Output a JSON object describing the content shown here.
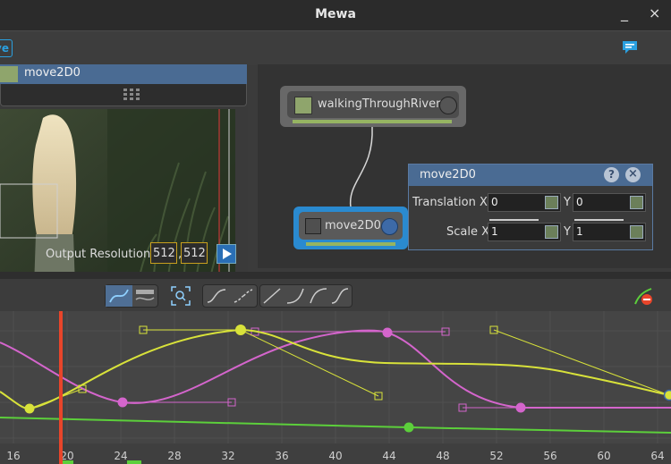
{
  "window": {
    "title": "Mewa",
    "minimize": "_",
    "close": "×"
  },
  "toolbar": {
    "save_fragment": "ve"
  },
  "viewer": {
    "node_name": "move2D0",
    "output_resolution_label": "Output Resolution:",
    "width": "512",
    "height": "512",
    "separator": ","
  },
  "nodes": [
    {
      "name": "walkingThroughRiver0",
      "color": "#8fa56c"
    },
    {
      "name": "move2D0",
      "color": "#2a8ad0"
    }
  ],
  "properties": {
    "title": "move2D0",
    "help": "?",
    "close": "×",
    "translation_x_label": "Translation X",
    "translation_x": "0",
    "translation_y_label": "Y",
    "translation_y": "0",
    "scale_x_label": "Scale X",
    "scale_x": "1",
    "scale_y_label": "Y",
    "scale_y": "1"
  },
  "timeline": {
    "ticks": [
      "16",
      "20",
      "24",
      "28",
      "32",
      "36",
      "40",
      "44",
      "48",
      "52",
      "56",
      "60",
      "64"
    ],
    "current_frame_color": "#e8452a",
    "curve_colors": {
      "yellow": "#d8e23a",
      "magenta": "#d465cc",
      "green": "#5ccf3b"
    }
  }
}
